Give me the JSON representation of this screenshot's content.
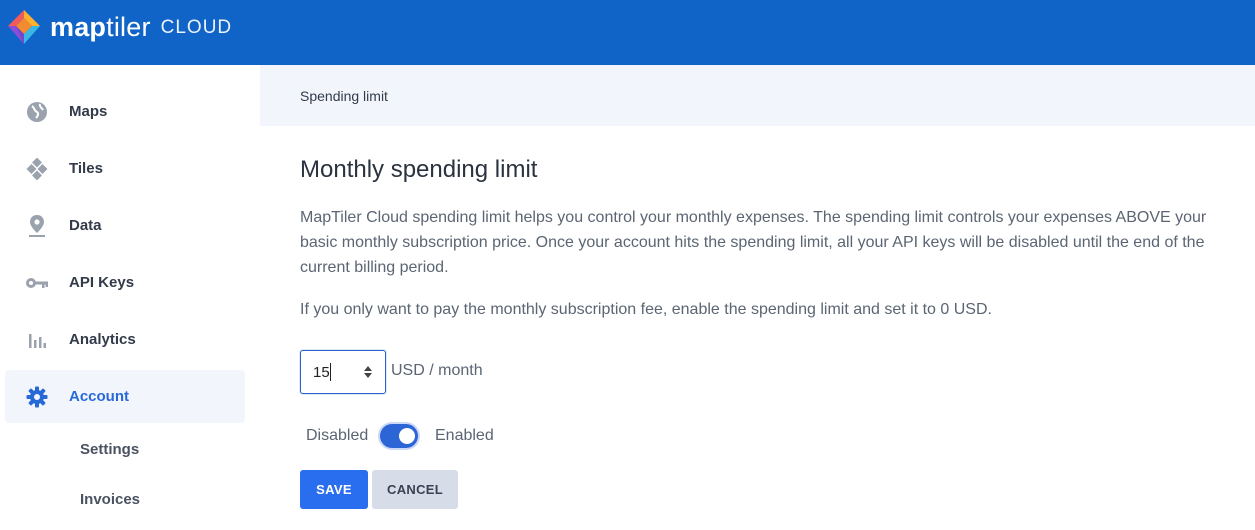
{
  "header": {
    "brand_bold": "map",
    "brand_light": "tiler",
    "brand_sub": "CLOUD",
    "bg_color": "#1064c8"
  },
  "sidebar": {
    "items": [
      {
        "label": "Maps",
        "icon": "globe-icon"
      },
      {
        "label": "Tiles",
        "icon": "tiles-icon"
      },
      {
        "label": "Data",
        "icon": "pin-icon"
      },
      {
        "label": "API Keys",
        "icon": "key-icon"
      },
      {
        "label": "Analytics",
        "icon": "analytics-icon"
      },
      {
        "label": "Account",
        "icon": "gear-icon",
        "active": true
      }
    ],
    "sub_items": [
      {
        "label": "Settings"
      },
      {
        "label": "Invoices"
      }
    ],
    "active_color": "#2869d8"
  },
  "breadcrumb": "Spending limit",
  "main": {
    "title": "Monthly spending limit",
    "paragraph1": "MapTiler Cloud spending limit helps you control your monthly expenses. The spending limit controls your expenses ABOVE your basic monthly subscription price. Once your account hits the spending limit, all your API keys will be disabled until the end of the current billing period.",
    "paragraph2": "If you only want to pay the monthly subscription fee, enable the spending limit and set it to 0 USD.",
    "limit_value": "15",
    "unit_label": "USD / month",
    "toggle_off_label": "Disabled",
    "toggle_on_label": "Enabled",
    "toggle_enabled": true,
    "save_label": "SAVE",
    "cancel_label": "CANCEL",
    "accent_color": "#2a6ef0"
  }
}
